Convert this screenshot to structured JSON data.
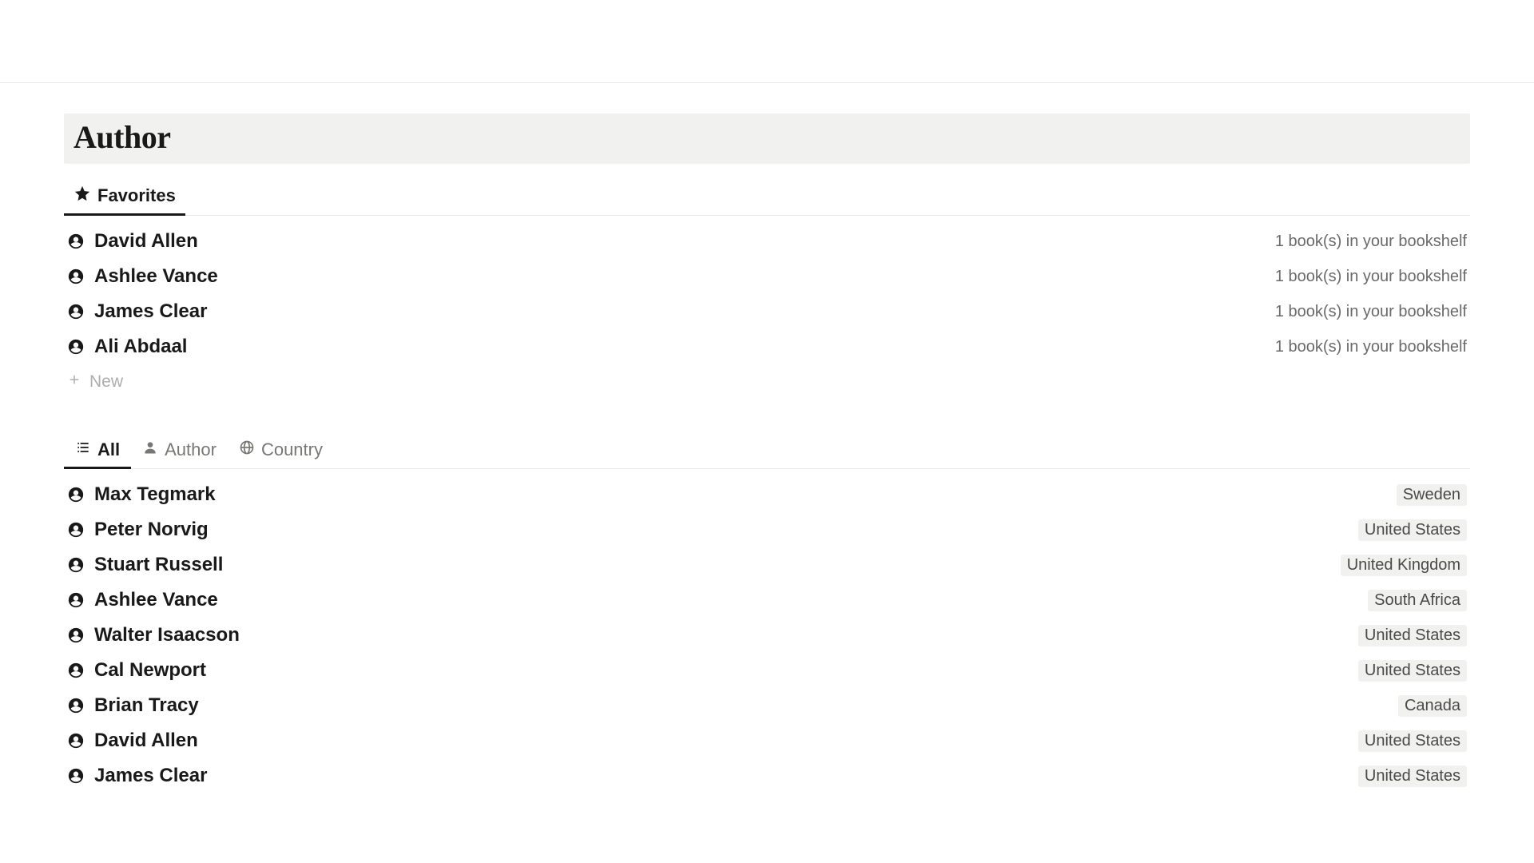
{
  "page": {
    "title": "Author"
  },
  "favoritesTab": {
    "label": "Favorites"
  },
  "favorites": [
    {
      "name": "David Allen",
      "meta": "1 book(s) in your bookshelf"
    },
    {
      "name": "Ashlee Vance",
      "meta": "1 book(s) in your bookshelf"
    },
    {
      "name": "James Clear",
      "meta": "1 book(s) in your bookshelf"
    },
    {
      "name": "Ali Abdaal",
      "meta": "1 book(s) in your bookshelf"
    }
  ],
  "newButton": {
    "label": "New"
  },
  "viewTabs": {
    "all": "All",
    "author": "Author",
    "country": "Country"
  },
  "authors": [
    {
      "name": "Max Tegmark",
      "country": "Sweden"
    },
    {
      "name": "Peter Norvig",
      "country": "United States"
    },
    {
      "name": "Stuart Russell",
      "country": "United Kingdom"
    },
    {
      "name": "Ashlee Vance",
      "country": "South Africa"
    },
    {
      "name": "Walter Isaacson",
      "country": "United States"
    },
    {
      "name": "Cal Newport",
      "country": "United States"
    },
    {
      "name": "Brian Tracy",
      "country": "Canada"
    },
    {
      "name": "David Allen",
      "country": "United States"
    },
    {
      "name": "James Clear",
      "country": "United States"
    }
  ]
}
